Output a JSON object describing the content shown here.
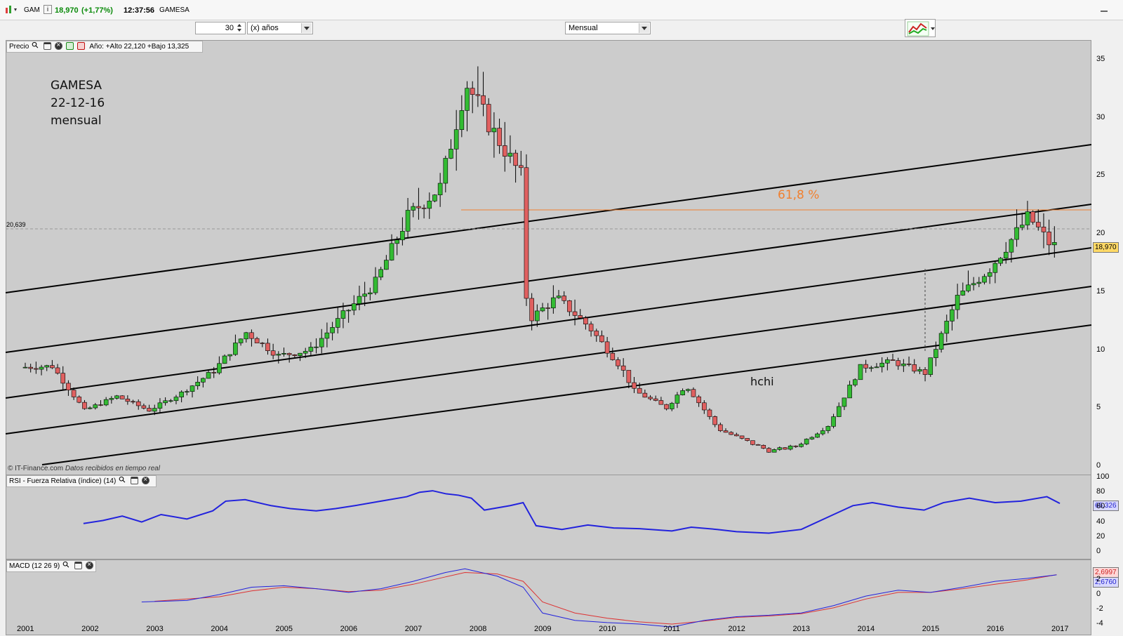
{
  "header": {
    "symbol": "GAM",
    "last": "18,970",
    "change": "(+1,77%)",
    "time": "12:37:56",
    "name": "GAMESA",
    "info_icon": "i"
  },
  "toolbar": {
    "period_value": "30",
    "period_unit": "(x) años",
    "interval": "Mensual"
  },
  "price_panel": {
    "label": "Precio",
    "stats": "Año: +Alto 22,120 +Bajo 13,325",
    "ref_level": "20,639",
    "last_price_tag": "18,970",
    "copyright": "© IT-Finance.com",
    "copyright_note": "Datos recibidos en tiempo real",
    "y_ticks": [
      "35",
      "30",
      "25",
      "20",
      "15",
      "10",
      "5",
      "0"
    ]
  },
  "annotations": {
    "title_line1": "GAMESA",
    "title_line2": "22-12-16",
    "title_line3": "mensual",
    "fib_label": "61,8 %",
    "pattern_label": "hchi",
    "fib_color": "#f08030"
  },
  "rsi_panel": {
    "label": "RSI - Fuerza Relativa (índice) (14)",
    "value_tag": "65,326",
    "y_ticks": [
      "100",
      "80",
      "60",
      "40",
      "20",
      "0"
    ],
    "line_color": "#2222dd"
  },
  "macd_panel": {
    "label": "MACD (12 26 9)",
    "value_signal": "2,6997",
    "value_macd": "2,6760",
    "y_ticks": [
      "2",
      "0",
      "-2",
      "-4"
    ],
    "macd_color": "#2222dd",
    "signal_color": "#dd3333"
  },
  "x_axis": {
    "years": [
      "2001",
      "2002",
      "2003",
      "2004",
      "2005",
      "2006",
      "2007",
      "2008",
      "2009",
      "2010",
      "2011",
      "2012",
      "2013",
      "2014",
      "2015",
      "2016",
      "2017"
    ]
  },
  "colors": {
    "up_candle": "#33bb33",
    "down_candle": "#e06060",
    "panel_bg": "#cccccc"
  },
  "chart_data": [
    {
      "type": "candlestick",
      "title": "GAMESA",
      "interval": "monthly",
      "ylim": [
        0,
        36
      ],
      "x_range": [
        "2001-01",
        "2017-01"
      ],
      "series": [
        {
          "name": "",
          "x": [
            2001.0,
            2001.5,
            2002.0,
            2002.5,
            2003.0,
            2003.5,
            2004.0,
            2004.5,
            2005.0,
            2005.5,
            2006.0,
            2006.5,
            2007.0,
            2007.5,
            2007.9,
            2008.3,
            2008.75,
            2008.85,
            2009.3,
            2009.8,
            2010.3,
            2010.5,
            2011.0,
            2011.3,
            2011.8,
            2012.3,
            2012.6,
            2013.0,
            2013.5,
            2014.0,
            2014.5,
            2015.0,
            2015.5,
            2016.0,
            2016.6,
            2016.95
          ],
          "values": [
            8.5,
            8.6,
            4.8,
            6.0,
            4.8,
            6.3,
            8.2,
            11.5,
            9.5,
            10.0,
            13.0,
            15.8,
            21.5,
            24.0,
            33.0,
            29.0,
            25.0,
            12.5,
            14.5,
            12.0,
            8.5,
            6.5,
            5.0,
            7.0,
            3.2,
            2.0,
            1.3,
            1.7,
            3.5,
            8.5,
            9.0,
            8.0,
            14.5,
            17.0,
            21.5,
            18.97
          ]
        }
      ]
    },
    {
      "type": "line",
      "title": "RSI - Fuerza Relativa (índice) (14)",
      "ylim": [
        0,
        100
      ],
      "series": [
        {
          "name": "RSI",
          "x": [
            2001.9,
            2002.2,
            2002.5,
            2002.8,
            2003.1,
            2003.5,
            2003.9,
            2004.1,
            2004.4,
            2004.8,
            2005.1,
            2005.5,
            2005.8,
            2006.1,
            2006.5,
            2006.9,
            2007.1,
            2007.3,
            2007.5,
            2007.7,
            2007.9,
            2008.1,
            2008.5,
            2008.7,
            2008.9,
            2009.3,
            2009.7,
            2010.1,
            2010.5,
            2011.0,
            2011.3,
            2011.7,
            2012.0,
            2012.5,
            2013.0,
            2013.5,
            2013.8,
            2014.1,
            2014.5,
            2014.9,
            2015.2,
            2015.6,
            2016.0,
            2016.4,
            2016.8,
            2017.0
          ],
          "values": [
            38,
            42,
            48,
            40,
            50,
            44,
            55,
            68,
            70,
            62,
            58,
            55,
            58,
            62,
            68,
            74,
            80,
            82,
            78,
            76,
            72,
            56,
            62,
            66,
            35,
            30,
            36,
            32,
            31,
            28,
            33,
            30,
            27,
            25,
            30,
            50,
            62,
            66,
            60,
            56,
            66,
            72,
            66,
            68,
            74,
            65
          ]
        }
      ]
    },
    {
      "type": "line",
      "title": "MACD (12 26 9)",
      "ylim": [
        -5,
        4
      ],
      "series": [
        {
          "name": "MACD",
          "x": [
            2002.8,
            2003.5,
            2004.0,
            2004.5,
            2005.0,
            2005.5,
            2006.0,
            2006.5,
            2007.0,
            2007.5,
            2007.8,
            2008.3,
            2008.7,
            2009.0,
            2009.5,
            2010.0,
            2010.5,
            2011.0,
            2011.5,
            2012.0,
            2012.5,
            2013.0,
            2013.5,
            2014.0,
            2014.5,
            2015.0,
            2015.5,
            2016.0,
            2016.5,
            2016.95
          ],
          "values": [
            -1,
            -0.8,
            0,
            1,
            1.2,
            0.8,
            0.3,
            0.8,
            1.8,
            3.0,
            3.5,
            2.5,
            1.0,
            -2.5,
            -3.5,
            -3.8,
            -4.0,
            -4.4,
            -3.5,
            -3.0,
            -2.8,
            -2.5,
            -1.5,
            -0.2,
            0.6,
            0.3,
            1.0,
            1.8,
            2.2,
            2.676
          ]
        },
        {
          "name": "Signal",
          "x": [
            2003.0,
            2004.0,
            2004.5,
            2005.0,
            2005.5,
            2006.0,
            2006.5,
            2007.0,
            2007.5,
            2007.8,
            2008.3,
            2008.7,
            2009.0,
            2009.5,
            2010.0,
            2010.5,
            2011.0,
            2011.5,
            2012.0,
            2012.5,
            2013.0,
            2013.5,
            2014.0,
            2014.5,
            2015.0,
            2015.5,
            2016.0,
            2016.5,
            2016.95
          ],
          "values": [
            -0.9,
            -0.3,
            0.5,
            1.0,
            0.8,
            0.4,
            0.6,
            1.4,
            2.4,
            3.0,
            2.8,
            1.8,
            -1.0,
            -2.5,
            -3.2,
            -3.7,
            -4.0,
            -3.6,
            -3.1,
            -2.9,
            -2.6,
            -1.8,
            -0.6,
            0.3,
            0.3,
            0.8,
            1.4,
            2.0,
            2.6997
          ]
        }
      ]
    }
  ]
}
